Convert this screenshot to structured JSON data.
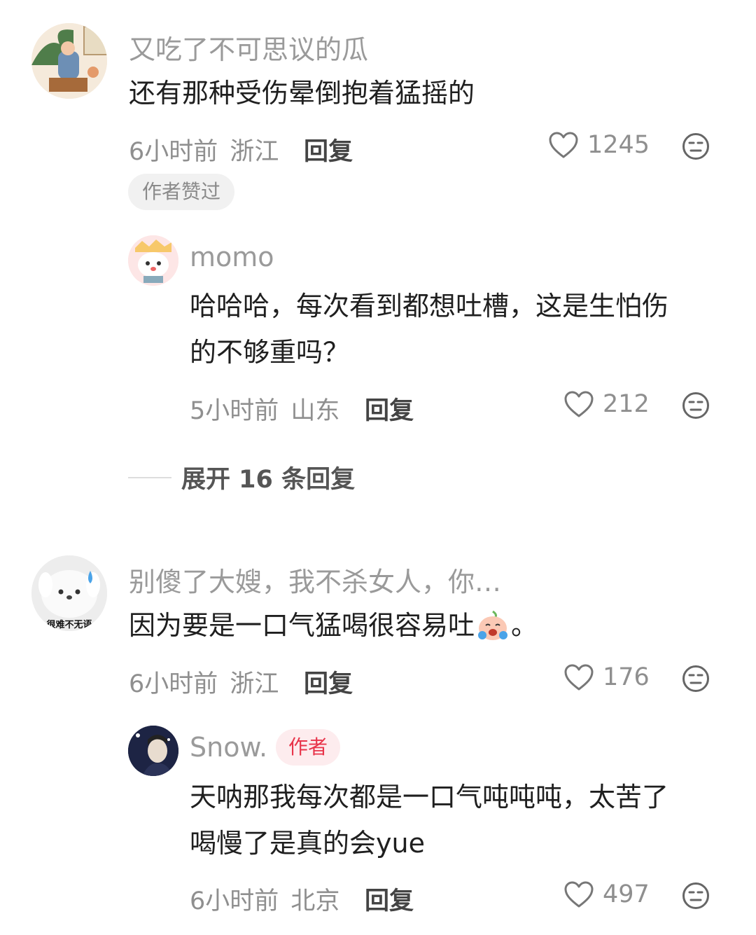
{
  "comments": [
    {
      "username": "又吃了不可思议的瓜",
      "text": "还有那种受伤晕倒抱着猛摇的",
      "time": "6小时前",
      "location": "浙江",
      "reply_label": "回复",
      "likes": "1245",
      "liked_by_author": "作者赞过",
      "replies": [
        {
          "username": "momo",
          "text_line1": "哈哈哈，每次看到都想吐槽，这是生怕伤",
          "text_line2": "的不够重吗？",
          "time": "5小时前",
          "location": "山东",
          "reply_label": "回复",
          "likes": "212"
        }
      ],
      "expand_label": "展开 16 条回复"
    },
    {
      "username": "别傻了大嫂，我不杀女人，你…",
      "avatar_text": "很难不无语",
      "text": "因为要是一口气猛喝很容易吐",
      "text_suffix": "。",
      "time": "6小时前",
      "location": "浙江",
      "reply_label": "回复",
      "likes": "176",
      "replies": [
        {
          "username": "Snow.",
          "badge": "作者",
          "text_line1": "天呐那我每次都是一口气吨吨吨，太苦了",
          "text_line2": "喝慢了是真的会yue",
          "time": "6小时前",
          "location": "北京",
          "reply_label": "回复",
          "likes": "497"
        }
      ]
    }
  ],
  "colors": {
    "author_badge_text": "#e8344a",
    "author_badge_bg": "#fdecee",
    "meta_text": "#8f8f8f"
  }
}
